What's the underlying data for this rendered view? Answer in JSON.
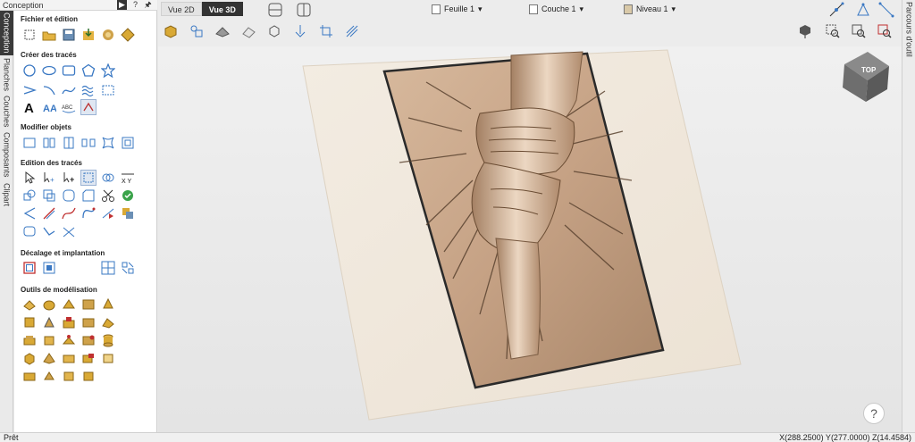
{
  "panel": {
    "title": "Conception",
    "sections": {
      "file": "Fichier et édition",
      "create": "Créer des tracés",
      "modify": "Modifier objets",
      "edit": "Edition des tracés",
      "offset": "Décalage et implantation",
      "modeling": "Outils de modélisation"
    }
  },
  "left_tabs": [
    "Conception",
    "Planches",
    "Couches",
    "Composants",
    "Clipart"
  ],
  "view": {
    "view2d": "Vue 2D",
    "view3d": "Vue 3D",
    "active": "Vue 3D"
  },
  "dropdowns": {
    "sheet": "Feuille 1",
    "layer": "Couche 1",
    "level": "Niveau 1"
  },
  "right_tab": "Parcours d'outil",
  "viewcube_label": "TOP",
  "help": "?",
  "status": {
    "left": "Prêt",
    "coords": "X(288.2500) Y(277.0000) Z(14.4584)"
  },
  "colors": {
    "accent": "#3a78c3",
    "tool_gold": "#d9a935",
    "model": "#c9a98e"
  }
}
